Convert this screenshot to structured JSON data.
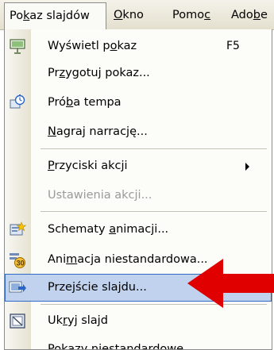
{
  "menubar": {
    "items": [
      {
        "label": "Pokaz slajdów",
        "mnemonic_index": 2
      },
      {
        "label": "Okno",
        "mnemonic_index": 0
      },
      {
        "label": "Pomoc",
        "mnemonic_index": 4
      },
      {
        "label": "Adobe",
        "mnemonic_index": 3
      }
    ]
  },
  "menu": {
    "items": [
      {
        "label": "Wyświetl pokaz",
        "mnemonic_index": 10,
        "shortcut": "F5",
        "icon": "projector-screen-icon"
      },
      {
        "label": "Przygotuj pokaz...",
        "mnemonic_index": 2
      },
      {
        "label": "Próba tempa",
        "mnemonic_index": 3,
        "icon": "stopwatch-icon"
      },
      {
        "label": "Nagraj narrację...",
        "mnemonic_index": 0
      },
      {
        "label": "Przyciski akcji",
        "mnemonic_index": 0,
        "submenu": true
      },
      {
        "label": "Ustawienia akcji...",
        "mnemonic_index": 14,
        "disabled": true
      },
      {
        "label": "Schematy animacji...",
        "mnemonic_index": 9,
        "icon": "animation-scheme-icon"
      },
      {
        "label": "Animacja niestandardowa...",
        "mnemonic_index": 3,
        "icon": "custom-animation-icon"
      },
      {
        "label": "Przejście slajdu...",
        "mnemonic_index": 4,
        "icon": "slide-transition-icon",
        "highlighted": true
      },
      {
        "label": "Ukryj slajd",
        "mnemonic_index": 2,
        "icon": "hide-slide-icon"
      },
      {
        "label": "Pokazy niestandardowe...",
        "mnemonic_index": 10
      }
    ]
  },
  "colors": {
    "highlight_fill": "#c1d2ee",
    "highlight_border": "#316ac5",
    "annotation_arrow": "#e00000",
    "disabled_text": "#9a9a9a"
  }
}
